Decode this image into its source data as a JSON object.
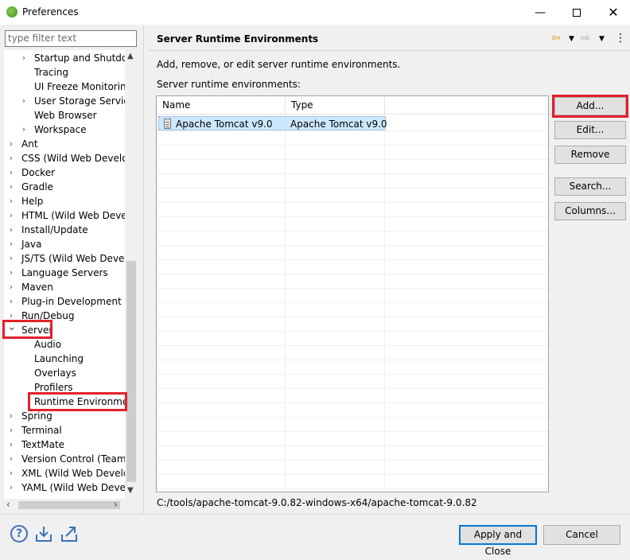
{
  "window": {
    "title": "Preferences"
  },
  "sidebar": {
    "filter_placeholder": "type filter text",
    "items": [
      {
        "label": "Startup and Shutdown",
        "level": 1,
        "expander": "collapsed"
      },
      {
        "label": "Tracing",
        "level": 1,
        "expander": "none"
      },
      {
        "label": "UI Freeze Monitoring",
        "level": 1,
        "expander": "none"
      },
      {
        "label": "User Storage Service",
        "level": 1,
        "expander": "collapsed"
      },
      {
        "label": "Web Browser",
        "level": 1,
        "expander": "none"
      },
      {
        "label": "Workspace",
        "level": 1,
        "expander": "collapsed"
      },
      {
        "label": "Ant",
        "level": 0,
        "expander": "collapsed"
      },
      {
        "label": "CSS (Wild Web Developer)",
        "level": 0,
        "expander": "collapsed"
      },
      {
        "label": "Docker",
        "level": 0,
        "expander": "collapsed"
      },
      {
        "label": "Gradle",
        "level": 0,
        "expander": "collapsed"
      },
      {
        "label": "Help",
        "level": 0,
        "expander": "collapsed"
      },
      {
        "label": "HTML (Wild Web Developer)",
        "level": 0,
        "expander": "collapsed"
      },
      {
        "label": "Install/Update",
        "level": 0,
        "expander": "collapsed"
      },
      {
        "label": "Java",
        "level": 0,
        "expander": "collapsed"
      },
      {
        "label": "JS/TS (Wild Web Developer)",
        "level": 0,
        "expander": "collapsed"
      },
      {
        "label": "Language Servers",
        "level": 0,
        "expander": "collapsed"
      },
      {
        "label": "Maven",
        "level": 0,
        "expander": "collapsed"
      },
      {
        "label": "Plug-in Development",
        "level": 0,
        "expander": "collapsed"
      },
      {
        "label": "Run/Debug",
        "level": 0,
        "expander": "collapsed"
      },
      {
        "label": "Server",
        "level": 0,
        "expander": "expanded"
      },
      {
        "label": "Audio",
        "level": 1,
        "expander": "none"
      },
      {
        "label": "Launching",
        "level": 1,
        "expander": "none"
      },
      {
        "label": "Overlays",
        "level": 1,
        "expander": "none"
      },
      {
        "label": "Profilers",
        "level": 1,
        "expander": "none"
      },
      {
        "label": "Runtime Environments",
        "level": 1,
        "expander": "none"
      },
      {
        "label": "Spring",
        "level": 0,
        "expander": "collapsed"
      },
      {
        "label": "Terminal",
        "level": 0,
        "expander": "collapsed"
      },
      {
        "label": "TextMate",
        "level": 0,
        "expander": "collapsed"
      },
      {
        "label": "Version Control (Team)",
        "level": 0,
        "expander": "collapsed"
      },
      {
        "label": "XML (Wild Web Developer)",
        "level": 0,
        "expander": "collapsed"
      },
      {
        "label": "YAML (Wild Web Developer)",
        "level": 0,
        "expander": "collapsed"
      }
    ]
  },
  "page": {
    "title": "Server Runtime Environments",
    "description": "Add, remove, or edit server runtime environments.",
    "list_label": "Server runtime environments:",
    "columns": [
      "Name",
      "Type"
    ],
    "rows": [
      {
        "name": "Apache Tomcat v9.0",
        "type": "Apache Tomcat v9.0",
        "selected": true
      }
    ],
    "buttons": {
      "add": "Add...",
      "edit": "Edit...",
      "remove": "Remove",
      "search": "Search...",
      "columns": "Columns..."
    },
    "location_path": "C:/tools/apache-tomcat-9.0.82-windows-x64/apache-tomcat-9.0.82"
  },
  "footer": {
    "apply_close": "Apply and Close",
    "cancel": "Cancel"
  },
  "icons": {
    "back": "back-arrow-icon",
    "forward": "forward-arrow-icon",
    "menu": "view-menu-icon",
    "help": "help-icon",
    "import": "import-icon",
    "export": "export-icon"
  },
  "colors": {
    "highlight_box": "#e3202a",
    "selection": "#cce8ff",
    "default_button_border": "#0078d7"
  }
}
